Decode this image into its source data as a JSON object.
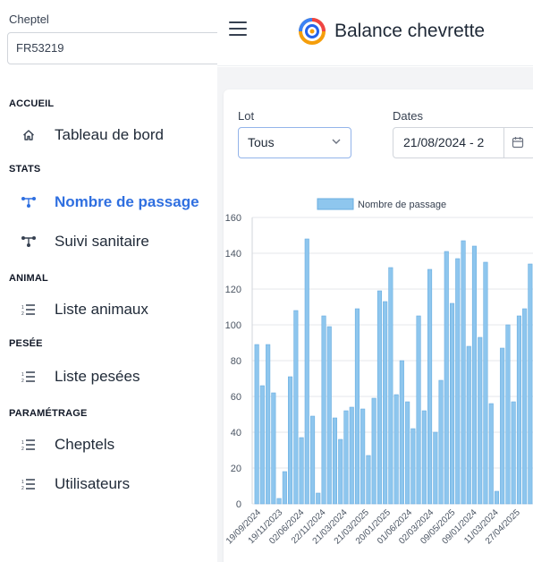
{
  "sidebar": {
    "cheptel_label": "Cheptel",
    "cheptel_value": "FR53219",
    "sections": [
      {
        "title": "ACCUEIL",
        "items": [
          {
            "label": "Tableau de bord",
            "icon": "home-icon",
            "active": false
          }
        ]
      },
      {
        "title": "STATS",
        "items": [
          {
            "label": "Nombre de passage",
            "icon": "graph-nodes-icon",
            "active": true
          },
          {
            "label": "Suivi sanitaire",
            "icon": "graph-nodes-icon",
            "active": false
          }
        ]
      },
      {
        "title": "ANIMAL",
        "items": [
          {
            "label": "Liste animaux",
            "icon": "numbered-list-icon",
            "active": false
          }
        ]
      },
      {
        "title": "PESÉE",
        "items": [
          {
            "label": "Liste pesées",
            "icon": "numbered-list-icon",
            "active": false
          }
        ]
      },
      {
        "title": "PARAMÉTRAGE",
        "items": [
          {
            "label": "Cheptels",
            "icon": "numbered-list-icon",
            "active": false
          },
          {
            "label": "Utilisateurs",
            "icon": "numbered-list-icon",
            "active": false
          }
        ]
      }
    ]
  },
  "header": {
    "title": "Balance chevrette",
    "menu_icon": "hamburger-menu-icon",
    "logo_icon": "app-logo-icon"
  },
  "filters": {
    "lot_label": "Lot",
    "lot_value": "Tous",
    "dates_label": "Dates",
    "dates_value": "21/08/2024 - 2"
  },
  "colors": {
    "accent": "#2f6fe0",
    "bar_fill": "#8ec6ee",
    "bar_stroke": "#6aaee0"
  },
  "chart_data": {
    "type": "bar",
    "legend": "Nombre de passage",
    "legend_position": "top",
    "grid": true,
    "ylim": [
      0,
      160
    ],
    "yticks": [
      0,
      20,
      40,
      60,
      80,
      100,
      120,
      140,
      160
    ],
    "x_tick_labels": [
      "19/09/2024",
      "19/11/2023",
      "02/06/2024",
      "22/11/2024",
      "21/03/2024",
      "21/03/2025",
      "20/01/2025",
      "01/06/2024",
      "02/03/2024",
      "09/05/2025",
      "09/01/2024",
      "11/03/2024",
      "27/04/2025"
    ],
    "values": [
      89,
      66,
      89,
      62,
      3,
      18,
      71,
      108,
      37,
      148,
      49,
      6,
      105,
      99,
      48,
      36,
      52,
      54,
      109,
      53,
      27,
      59,
      119,
      113,
      132,
      61,
      80,
      57,
      42,
      105,
      52,
      131,
      40,
      69,
      141,
      112,
      137,
      147,
      88,
      144,
      93,
      135,
      56,
      7,
      87,
      100,
      57,
      105,
      109,
      134
    ]
  }
}
